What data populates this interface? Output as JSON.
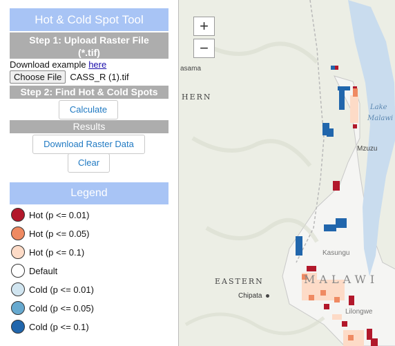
{
  "sidebar": {
    "title": "Hot & Cold Spot Tool",
    "step1": {
      "line1": "Step 1: Upload Raster File",
      "line2": "(*.tif)"
    },
    "download_example": {
      "text": "Download example",
      "link": "here"
    },
    "choose_file_label": "Choose File",
    "file_name": "CASS_R (1).tif",
    "step2": "Step 2: Find Hot & Cold Spots",
    "calculate_label": "Calculate",
    "results_label": "Results",
    "download_raster_label": "Download Raster Data",
    "clear_label": "Clear",
    "legend_title": "Legend",
    "legend_items": [
      {
        "label": "Hot (p <= 0.01)",
        "color": "#b2182b"
      },
      {
        "label": "Hot (p <= 0.05)",
        "color": "#ef8a62"
      },
      {
        "label": "Hot (p <= 0.1)",
        "color": "#fddbc7"
      },
      {
        "label": "Default",
        "color": "#ffffff"
      },
      {
        "label": "Cold (p <= 0.01)",
        "color": "#d1e5f0"
      },
      {
        "label": "Cold (p <= 0.05)",
        "color": "#67a9cf"
      },
      {
        "label": "Cold (p <= 0.1)",
        "color": "#2166ac"
      }
    ]
  },
  "map": {
    "zoom_in": "+",
    "zoom_out": "−",
    "labels": {
      "asama": "asama",
      "hern": "HERN",
      "lake_malawi_1": "Lake",
      "lake_malawi_2": "Malawi",
      "mzuzu": "Mzuzu",
      "kasungu": "Kasungu",
      "eastern": "EASTERN",
      "malawi": "MALAWI",
      "chipata": "Chipata",
      "lilongwe": "Lilongwe"
    },
    "colors": {
      "hot_high": "#b2182b",
      "hot_mid": "#ef8a62",
      "hot_low": "#fddbc7",
      "cold_high": "#2166ac",
      "lake": "#c9dcee",
      "land": "#eceee5",
      "country": "#f5f5f3"
    }
  }
}
